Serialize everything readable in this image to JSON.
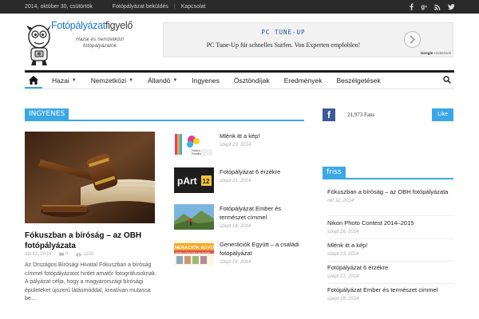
{
  "topbar": {
    "date": "2014, október 30, csütörtök",
    "links": [
      "Fotópályázat beküldés",
      "Kapcsolat"
    ],
    "social": [
      "facebook-icon",
      "google-plus-icon",
      "rss-icon",
      "twitter-icon"
    ]
  },
  "logo": {
    "brand_blue": "Fotópályázat",
    "brand_dark": "figyelő",
    "tagline": "Hazai és nemzetközi fotópályázatok"
  },
  "ad": {
    "title": "PC TUNE-UP",
    "text": "PC Tune-Up für schnelles Surfen. Von Experten empfohlen!",
    "badge_brand": "Google",
    "badge_label": "Hirdetések"
  },
  "nav": {
    "items": [
      {
        "label": "Hazai",
        "dropdown": true
      },
      {
        "label": "Nemzetközi",
        "dropdown": true
      },
      {
        "label": "Állandó",
        "dropdown": true
      },
      {
        "label": "Ingyenes",
        "dropdown": false
      },
      {
        "label": "Ösztöndíjak",
        "dropdown": false
      },
      {
        "label": "Eredmények",
        "dropdown": false
      },
      {
        "label": "Beszélgetések",
        "dropdown": false
      }
    ],
    "chevron": "⌄"
  },
  "section": {
    "label": "INGYENES"
  },
  "featured": {
    "title": "Fókuszban a bíróság – az OBH fotópályázata",
    "date": "okt 12, 2014",
    "comments": "0",
    "views": "1102",
    "excerpt": "Az Országos Bírósági Hivatal Fókuszban a bíróság címmel fotópályázatot hirdet amatőr fotográfusoknak. A pályázat célja, hogy a magyarországi bírósági épületeket újszerű látásmóddal, kreatívan mutassa be...."
  },
  "side_posts": [
    {
      "title": "Mlénk itt a kép!",
      "date": "szept 23, 2014"
    },
    {
      "title": "Fotópályázat 6 érzékre",
      "date": "szept 21, 2014"
    },
    {
      "title": "Fotópályázat Ember és természet címmel",
      "date": "szept 18, 2014"
    },
    {
      "title": "Generációk Együtt – a családi fotópályázat",
      "date": "szept 14, 2014"
    }
  ],
  "thumb_texts": {
    "part": "pArt",
    "part_num": "12",
    "generaciok": "NERÁCIÓK EGYÜ",
    "generaciok_sub": "DÁSNAP FOTÓPÁLYÁZAT A HAZ ANYÁNAK",
    "lenk_lines": [
      "Fotózz a",
      "Fesztivál"
    ]
  },
  "facebook": {
    "fans": "21,973 Fans",
    "like": "Like"
  },
  "friss": {
    "label": "friss",
    "items": [
      {
        "title": "Fókuszban a bíróság – az OBH fotópályázata",
        "date": "okt 12, 2014"
      },
      {
        "title": "Nikon Photo Contest 2014–2015",
        "date": "szept 26, 2014"
      },
      {
        "title": "Mlénk itt a kép!",
        "date": "szept 23, 2014"
      },
      {
        "title": "Fotópályázat 6 érzékre",
        "date": "szept 21, 2014"
      },
      {
        "title": "Fotópályázat Ember és természet címmel",
        "date": "szept 18, 2014"
      }
    ]
  },
  "colors": {
    "accent": "#3aa7e6",
    "facebook": "#3b5998",
    "topbar": "#2a2a2a"
  }
}
